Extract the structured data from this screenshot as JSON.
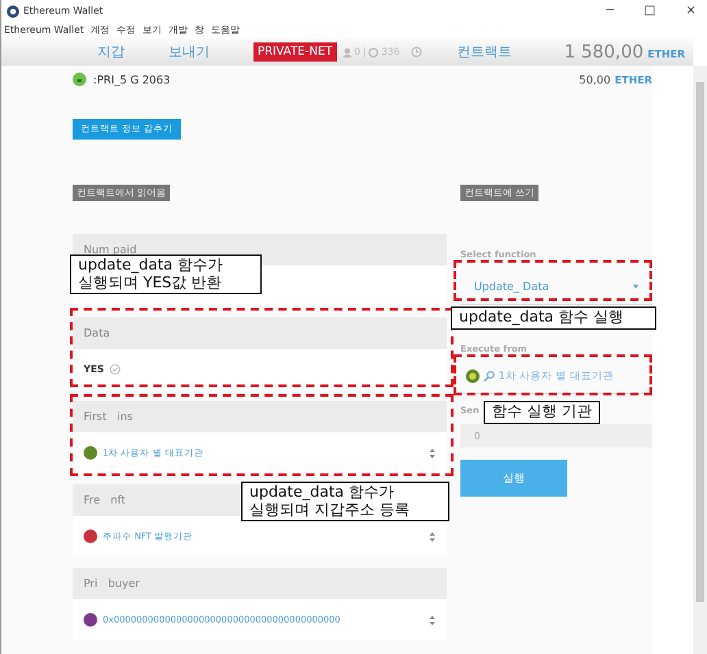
{
  "window": {
    "title": "Ethereum Wallet",
    "controls": [
      "─",
      "□",
      "×"
    ]
  },
  "menu": [
    "Ethereum Wallet",
    "계정",
    "수정",
    "보기",
    "개발",
    "창",
    "도움말"
  ],
  "nav": {
    "tabs": [
      {
        "label": "지갑",
        "selected": false
      },
      {
        "label": "보내기",
        "selected": false
      }
    ],
    "network": "PRIVATE-NET",
    "peers": "0",
    "separator": "|",
    "blocks": "336",
    "contracts_tab": {
      "label": "컨트랙트",
      "selected": false
    },
    "balance": "1 580,00",
    "unit": "ETHER"
  },
  "account": {
    "name": ":PRI_5 G 2063",
    "balance": "50,00",
    "unit": "ETHER"
  },
  "hide_button": "컨트랙트 정보 감추기",
  "read": {
    "title": "컨트랙트에서 읽어옴",
    "fields": [
      {
        "label": "Num paid",
        "kind": "empty"
      },
      {
        "label": "Data",
        "kind": "bool",
        "value": "YES"
      },
      {
        "label": "First   ins",
        "kind": "address",
        "value": "1차 사용자 별 대표기관",
        "color": "#5f8a2a"
      },
      {
        "label": "Fre   nft",
        "kind": "address",
        "value": "주파수 NFT 발행기관",
        "color": "#c8323a"
      },
      {
        "label": "Pri   buyer",
        "kind": "address",
        "value": "0x0000000000000000000000000000000000000000",
        "color": "#7a3a8c"
      }
    ]
  },
  "write": {
    "title": "컨트랙트에 쓰기",
    "select_label": "Select function",
    "function": "Update_ Data",
    "execute_label": "Execute from",
    "executor": "1차 사용자 별 대표기관",
    "send_label": "Sen",
    "send_value": "0",
    "button": "실행"
  },
  "callouts": [
    "update_data 함수가\n실행되며 YES값 반환",
    "update_data 함수 실행",
    "함수 실행 기관",
    "update_data 함수가\n실행되며 지갑주소 등록"
  ]
}
